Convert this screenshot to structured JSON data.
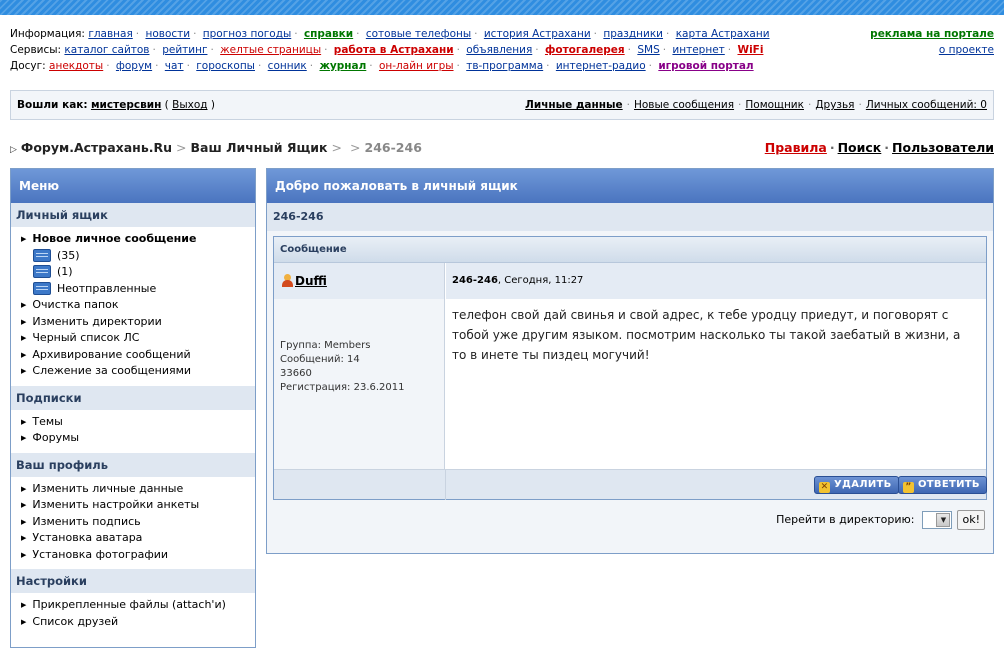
{
  "links": {
    "info_label": "Информация:",
    "info": [
      {
        "text": "главная",
        "style": ""
      },
      {
        "text": "новости",
        "style": ""
      },
      {
        "text": "прогноз погоды",
        "style": ""
      },
      {
        "text": "справки",
        "style": "green"
      },
      {
        "text": "сотовые телефоны",
        "style": ""
      },
      {
        "text": "история Астрахани",
        "style": ""
      },
      {
        "text": "праздники",
        "style": ""
      },
      {
        "text": "карта Астрахани",
        "style": ""
      }
    ],
    "services_label": "Сервисы:",
    "services": [
      {
        "text": "каталог сайтов",
        "style": ""
      },
      {
        "text": "рейтинг",
        "style": ""
      },
      {
        "text": "желтые страницы",
        "style": "red"
      },
      {
        "text": "работа в Астрахани",
        "style": "red bold"
      },
      {
        "text": "объявления",
        "style": ""
      },
      {
        "text": "фотогалерея",
        "style": "red bold"
      },
      {
        "text": "SMS",
        "style": ""
      },
      {
        "text": "интернет",
        "style": ""
      },
      {
        "text": "WiFi",
        "style": "red bold"
      }
    ],
    "leisure_label": "Досуг:",
    "leisure": [
      {
        "text": "анекдоты",
        "style": "red"
      },
      {
        "text": "форум",
        "style": ""
      },
      {
        "text": "чат",
        "style": ""
      },
      {
        "text": "гороскопы",
        "style": ""
      },
      {
        "text": "сонник",
        "style": ""
      },
      {
        "text": "журнал",
        "style": "green"
      },
      {
        "text": "он-лайн игры",
        "style": "red"
      },
      {
        "text": "тв-программа",
        "style": ""
      },
      {
        "text": "интернет-радио",
        "style": ""
      },
      {
        "text": "игровой портал",
        "style": "purple"
      }
    ]
  },
  "ad": {
    "advertise": "реклама на портале",
    "about": "о проекте"
  },
  "userbar": {
    "logged_in_as": "Вошли как:",
    "username": "мистерсвин",
    "logout": "Выход",
    "personal_data": "Личные данные",
    "new_messages": "Новые сообщения",
    "assistant": "Помощник",
    "friends": "Друзья",
    "pm_count": "Личных сообщений: 0"
  },
  "breadcrumb": {
    "forum": "Форум.Астрахань.Ru",
    "mailbox": "Ваш Личный Ящик",
    "current": "246-246"
  },
  "toplinks": {
    "rules": "Правила",
    "search": "Поиск",
    "users": "Пользователи"
  },
  "sidebar": {
    "title": "Меню",
    "sections": [
      {
        "title": "Личный ящик",
        "items": [
          "Новое личное сообщение"
        ],
        "folders": [
          "(35)",
          "(1)",
          "Неотправленные"
        ],
        "items_after": [
          "Очистка папок",
          "Изменить директории",
          "Черный список ЛС",
          "Архивирование сообщений",
          "Слежение за сообщениями"
        ]
      },
      {
        "title": "Подписки",
        "items": [
          "Темы",
          "Форумы"
        ]
      },
      {
        "title": "Ваш профиль",
        "items": [
          "Изменить личные данные",
          "Изменить настройки анкеты",
          "Изменить подпись",
          "Установка аватара",
          "Установка фотографии"
        ]
      },
      {
        "title": "Настройки",
        "items": [
          "Прикрепленные файлы (attach'и)",
          "Список друзей"
        ]
      }
    ]
  },
  "main": {
    "title": "Добро пожаловать в личный ящик",
    "subject": "246-246",
    "message_header": "Сообщение",
    "author": "Duffi",
    "info": {
      "group": "Группа: Members",
      "posts": "Сообщений: 14",
      "number": "33660",
      "registered": "Регистрация: 23.6.2011"
    },
    "msg_subject": "246-246",
    "msg_date": ", Сегодня, 11:27",
    "text": "телефон свой дай свинья и свой адрес, к тебе уродцу приедут, и поговорят с тобой уже другим языком. посмотрим насколько ты такой заебатый в жизни, а то в инете ты пиздец могучий!",
    "delete_btn": "УДАЛИТЬ",
    "reply_btn": "ОТВЕТИТЬ",
    "goto_label": "Перейти в директорию:",
    "goto_btn": "ok!"
  }
}
